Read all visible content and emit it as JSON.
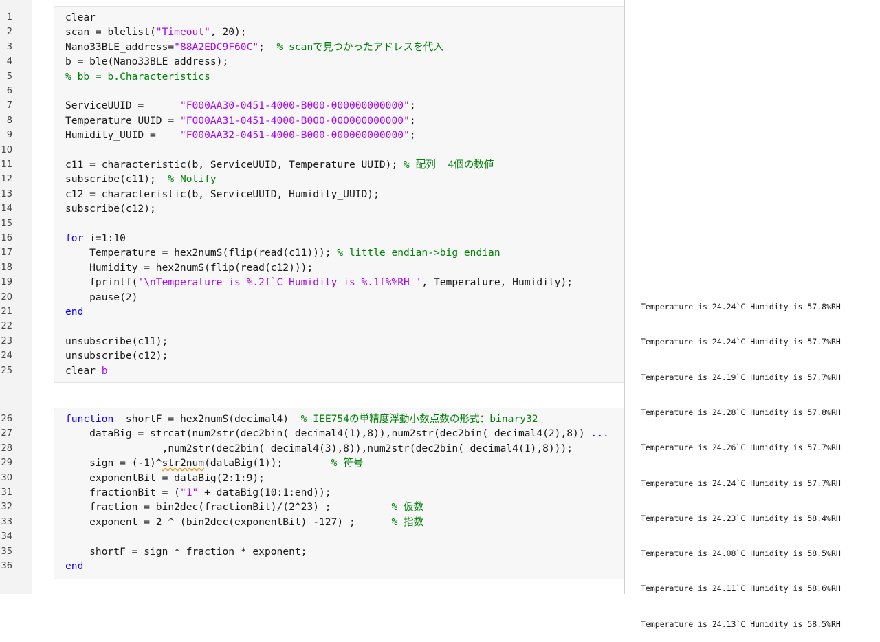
{
  "cell1": [
    {
      "num": "1",
      "segs": [
        {
          "t": "clear",
          "c": ""
        }
      ]
    },
    {
      "num": "2",
      "segs": [
        {
          "t": "scan = blelist(",
          "c": ""
        },
        {
          "t": "\"Timeout\"",
          "c": "str"
        },
        {
          "t": ", 20);",
          "c": ""
        }
      ]
    },
    {
      "num": "3",
      "segs": [
        {
          "t": "Nano33BLE_address=",
          "c": ""
        },
        {
          "t": "\"88A2EDC9F60C\"",
          "c": "str"
        },
        {
          "t": ";  ",
          "c": ""
        },
        {
          "t": "% scanで見つかったアドレスを代入",
          "c": "com"
        }
      ]
    },
    {
      "num": "4",
      "segs": [
        {
          "t": "b = ble(Nano33BLE_address);",
          "c": ""
        }
      ]
    },
    {
      "num": "5",
      "segs": [
        {
          "t": "% bb = b.Characteristics",
          "c": "com"
        }
      ]
    },
    {
      "num": "6",
      "segs": []
    },
    {
      "num": "7",
      "segs": [
        {
          "t": "ServiceUUID =      ",
          "c": ""
        },
        {
          "t": "\"F000AA30-0451-4000-B000-000000000000\"",
          "c": "str"
        },
        {
          "t": ";",
          "c": ""
        }
      ]
    },
    {
      "num": "8",
      "segs": [
        {
          "t": "Temperature_UUID = ",
          "c": ""
        },
        {
          "t": "\"F000AA31-0451-4000-B000-000000000000\"",
          "c": "str"
        },
        {
          "t": ";",
          "c": ""
        }
      ]
    },
    {
      "num": "9",
      "segs": [
        {
          "t": "Humidity_UUID =    ",
          "c": ""
        },
        {
          "t": "\"F000AA32-0451-4000-B000-000000000000\"",
          "c": "str"
        },
        {
          "t": ";",
          "c": ""
        }
      ]
    },
    {
      "num": "10",
      "segs": []
    },
    {
      "num": "11",
      "segs": [
        {
          "t": "c11 = characteristic(b, ServiceUUID, Temperature_UUID); ",
          "c": ""
        },
        {
          "t": "% 配列  4個の数値",
          "c": "com"
        }
      ]
    },
    {
      "num": "12",
      "segs": [
        {
          "t": "subscribe(c11);  ",
          "c": ""
        },
        {
          "t": "% Notify",
          "c": "com"
        }
      ]
    },
    {
      "num": "13",
      "segs": [
        {
          "t": "c12 = characteristic(b, ServiceUUID, Humidity_UUID);",
          "c": ""
        }
      ]
    },
    {
      "num": "14",
      "segs": [
        {
          "t": "subscribe(c12);",
          "c": ""
        }
      ]
    },
    {
      "num": "15",
      "segs": []
    },
    {
      "num": "16",
      "segs": [
        {
          "t": "for",
          "c": "kw"
        },
        {
          "t": " i=1:10",
          "c": ""
        }
      ]
    },
    {
      "num": "17",
      "segs": [
        {
          "t": "    Temperature = hex2numS(flip(read(c11))); ",
          "c": ""
        },
        {
          "t": "% little endian->big endian",
          "c": "com"
        }
      ]
    },
    {
      "num": "18",
      "segs": [
        {
          "t": "    Humidity = hex2numS(flip(read(c12)));",
          "c": ""
        }
      ]
    },
    {
      "num": "19",
      "segs": [
        {
          "t": "    fprintf(",
          "c": ""
        },
        {
          "t": "'\\nTemperature is %.2f`C Humidity is %.1f%%RH '",
          "c": "str"
        },
        {
          "t": ", Temperature, Humidity);",
          "c": ""
        }
      ]
    },
    {
      "num": "20",
      "segs": [
        {
          "t": "    pause(2)",
          "c": ""
        }
      ]
    },
    {
      "num": "21",
      "segs": [
        {
          "t": "end",
          "c": "kw"
        }
      ]
    },
    {
      "num": "22",
      "segs": []
    },
    {
      "num": "23",
      "segs": [
        {
          "t": "unsubscribe(c11);",
          "c": ""
        }
      ]
    },
    {
      "num": "24",
      "segs": [
        {
          "t": "unsubscribe(c12);",
          "c": ""
        }
      ]
    },
    {
      "num": "25",
      "segs": [
        {
          "t": "clear ",
          "c": ""
        },
        {
          "t": "b",
          "c": "str"
        }
      ]
    }
  ],
  "cell2": [
    {
      "num": "26",
      "segs": [
        {
          "t": "function",
          "c": "kw"
        },
        {
          "t": "  shortF = hex2numS(decimal4)  ",
          "c": ""
        },
        {
          "t": "% IEE754の単精度浮動小数点数の形式：binary32",
          "c": "com"
        }
      ]
    },
    {
      "num": "27",
      "segs": [
        {
          "t": "    dataBig = strcat(num2str(dec2bin( decimal4(1),8)),num2str(dec2bin( decimal4(2),8)) ",
          "c": ""
        },
        {
          "t": "...",
          "c": "kw"
        }
      ]
    },
    {
      "num": "28",
      "segs": [
        {
          "t": "                ,num2str(dec2bin( decimal4(3),8)),num2str(dec2bin( decimal4(1),8)));",
          "c": ""
        }
      ]
    },
    {
      "num": "29",
      "segs": [
        {
          "t": "    sign = (-1)^",
          "c": ""
        },
        {
          "t": "str2num",
          "c": "warn"
        },
        {
          "t": "(dataBig(1));        ",
          "c": ""
        },
        {
          "t": "% 符号",
          "c": "com"
        }
      ]
    },
    {
      "num": "30",
      "segs": [
        {
          "t": "    exponentBit = dataBig(2:1:9);",
          "c": ""
        }
      ]
    },
    {
      "num": "31",
      "segs": [
        {
          "t": "    fractionBit = (",
          "c": ""
        },
        {
          "t": "\"1\"",
          "c": "str"
        },
        {
          "t": " + dataBig(10:1:end));",
          "c": ""
        }
      ]
    },
    {
      "num": "32",
      "segs": [
        {
          "t": "    fraction = bin2dec(fractionBit)/(2^23) ;          ",
          "c": ""
        },
        {
          "t": "% 仮数",
          "c": "com"
        }
      ]
    },
    {
      "num": "33",
      "segs": [
        {
          "t": "    exponent = 2 ^ (bin2dec(exponentBit) -127) ;      ",
          "c": ""
        },
        {
          "t": "% 指数",
          "c": "com"
        }
      ]
    },
    {
      "num": "34",
      "segs": []
    },
    {
      "num": "35",
      "segs": [
        {
          "t": "    shortF = sign * fraction * exponent;",
          "c": ""
        }
      ]
    },
    {
      "num": "36",
      "segs": [
        {
          "t": "end",
          "c": "kw"
        }
      ]
    }
  ],
  "output": [
    "Temperature is 24.24`C Humidity is 57.8%RH",
    "Temperature is 24.24`C Humidity is 57.7%RH",
    "Temperature is 24.19`C Humidity is 57.7%RH",
    "Temperature is 24.28`C Humidity is 57.8%RH",
    "Temperature is 24.26`C Humidity is 57.7%RH",
    "Temperature is 24.24`C Humidity is 57.7%RH",
    "Temperature is 24.23`C Humidity is 58.4%RH",
    "Temperature is 24.08`C Humidity is 58.5%RH",
    "Temperature is 24.11`C Humidity is 58.6%RH",
    "Temperature is 24.13`C Humidity is 58.5%RH"
  ],
  "colors": {
    "keyword": "#0e00ff",
    "string": "#a709f5",
    "comment": "#028009",
    "section_divider": "#3a8fd8"
  }
}
